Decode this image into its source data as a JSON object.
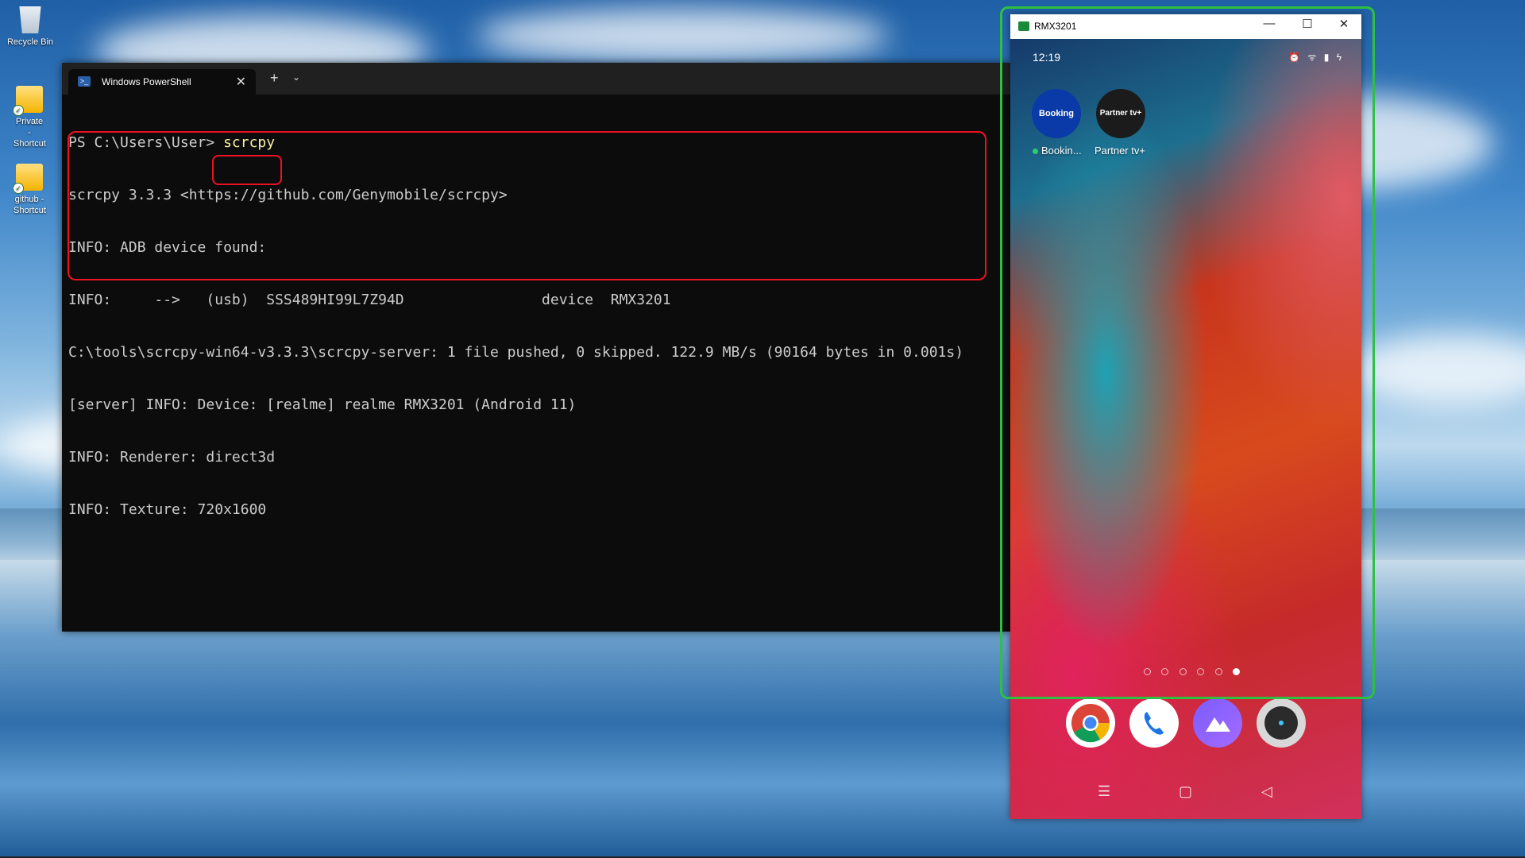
{
  "desktop": {
    "icons": [
      {
        "label": "Recycle Bin"
      },
      {
        "label": "Private - Shortcut"
      },
      {
        "label": "github - Shortcut"
      }
    ]
  },
  "terminal": {
    "tab_title": "Windows PowerShell",
    "tab_close": "✕",
    "new_tab": "+",
    "dropdown": "⌄",
    "prompt": "PS C:\\Users\\User> ",
    "command": "scrcpy",
    "lines": [
      "scrcpy 3.3.3 <https://github.com/Genymobile/scrcpy>",
      "INFO: ADB device found:",
      "INFO:     -->   (usb)  SSS489HI99L7Z94D                device  RMX3201",
      "C:\\tools\\scrcpy-win64-v3.3.3\\scrcpy-server: 1 file pushed, 0 skipped. 122.9 MB/s (90164 bytes in 0.001s)",
      "[server] INFO: Device: [realme] realme RMX3201 (Android 11)",
      "INFO: Renderer: direct3d",
      "INFO: Texture: 720x1600"
    ]
  },
  "scrcpy_window": {
    "title": "RMX3201",
    "minimize": "—",
    "maximize": "☐",
    "close": "✕"
  },
  "phone": {
    "time": "12:19",
    "status_icons": "⏰ ᯤ ▮ ϟ",
    "apps": [
      {
        "icon_text": "Booking",
        "label": "Bookin..."
      },
      {
        "icon_text": "Partner tv+",
        "label": "Partner tv+"
      }
    ],
    "page_count": 6,
    "active_page": 6,
    "dock": [
      "chrome-icon",
      "phone-icon",
      "gallery-icon",
      "camera-icon"
    ],
    "nav": {
      "menu": "☰",
      "home": "▢",
      "back": "◁"
    }
  },
  "colors": {
    "highlight_red": "#ee1122",
    "highlight_green": "#2fbf43",
    "terminal_bg": "#0c0c0c",
    "command_yellow": "#f9f1a5"
  }
}
